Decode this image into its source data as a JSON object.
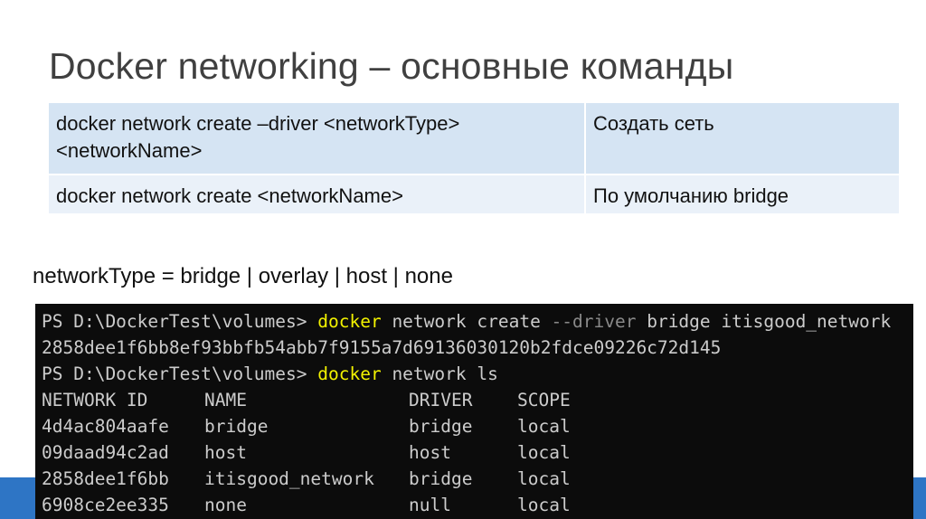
{
  "slide": {
    "title": "Docker networking – основные команды"
  },
  "command_table": {
    "rows": [
      {
        "command_line1": "docker network create –driver <networkType>",
        "command_line2": "<networkName>",
        "description": "Создать сеть"
      },
      {
        "command_line1": "docker network create <networkName>",
        "description": "По умолчанию bridge"
      }
    ]
  },
  "note": "networkType = bridge | overlay | host | none",
  "terminal": {
    "line1": {
      "prompt": "PS D:\\DockerTest\\volumes> ",
      "cmd": "docker",
      "args1": " network create ",
      "flag": "--driver",
      "args2": " bridge itisgood_network"
    },
    "line2": "2858dee1f6bb8ef93bbfb54abb7f9155a7d69136030120b2fdce09226c72d145",
    "line3": {
      "prompt": "PS D:\\DockerTest\\volumes> ",
      "cmd": "docker",
      "args": " network ls"
    },
    "headers": [
      "NETWORK ID",
      "NAME",
      "DRIVER",
      "SCOPE"
    ],
    "rows": [
      [
        "4d4ac804aafe",
        "bridge",
        "bridge",
        "local"
      ],
      [
        "09daad94c2ad",
        "host",
        "host",
        "local"
      ],
      [
        "2858dee1f6bb",
        "itisgood_network",
        "bridge",
        "local"
      ],
      [
        "6908ce2ee335",
        "none",
        "null",
        "local"
      ]
    ]
  },
  "colors": {
    "title": "#404040",
    "table_row_dark": "#d5e4f3",
    "table_row_light": "#eaf1f9",
    "terminal_bg": "#0c0c0c",
    "terminal_text": "#cccccc",
    "terminal_keyword": "#f2f200",
    "terminal_flag": "#8a8a8a",
    "accent_bar": "#2e75c5"
  }
}
